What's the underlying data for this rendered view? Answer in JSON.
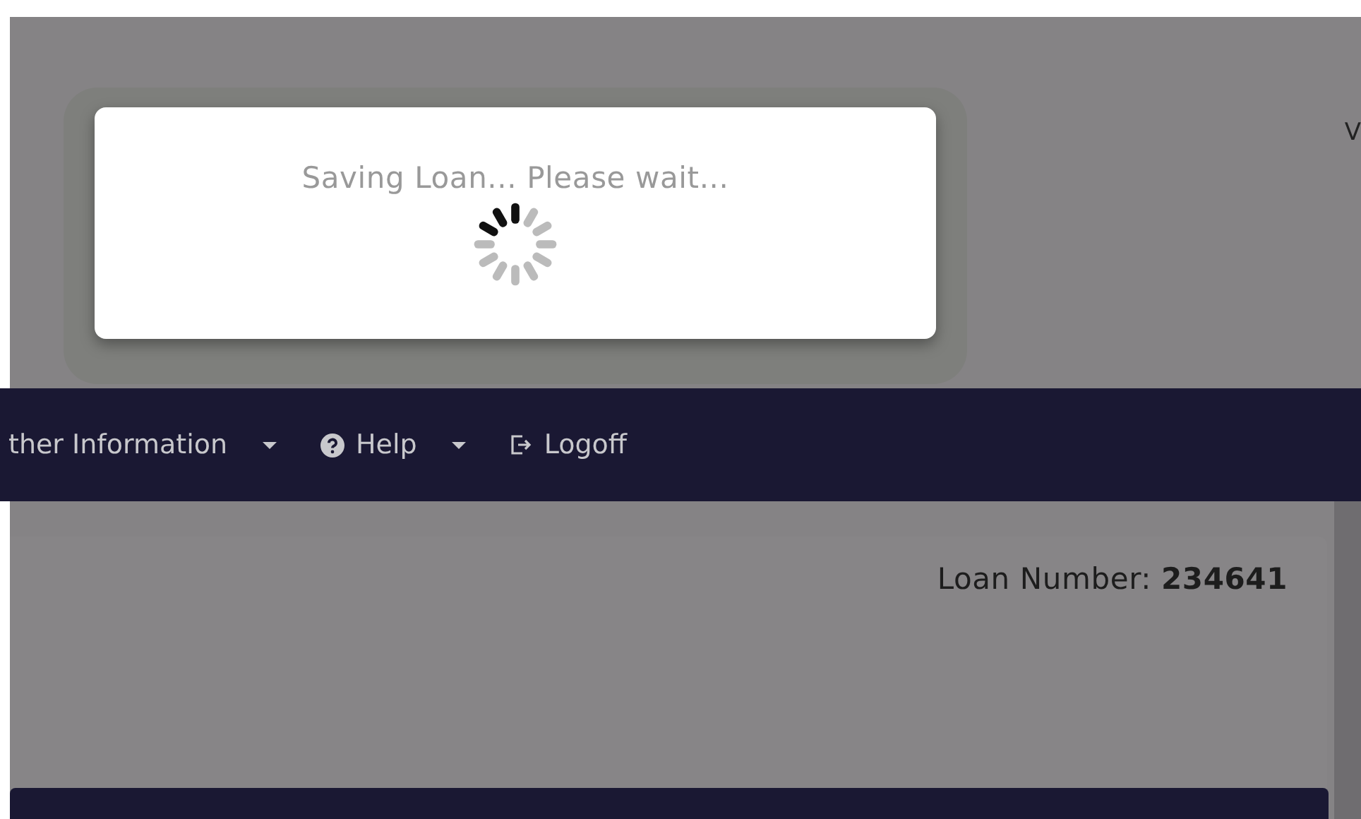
{
  "header": {
    "cut_text": "V"
  },
  "dialog": {
    "message": "Saving Loan... Please wait..."
  },
  "nav": [
    {
      "label": "ther Information",
      "kind": "plain",
      "dropdown": true
    },
    {
      "label": "Help",
      "kind": "help",
      "dropdown": true
    },
    {
      "label": "Logoff",
      "kind": "logoff",
      "dropdown": false
    }
  ],
  "loan": {
    "text": "Loan Number: **234641**"
  }
}
